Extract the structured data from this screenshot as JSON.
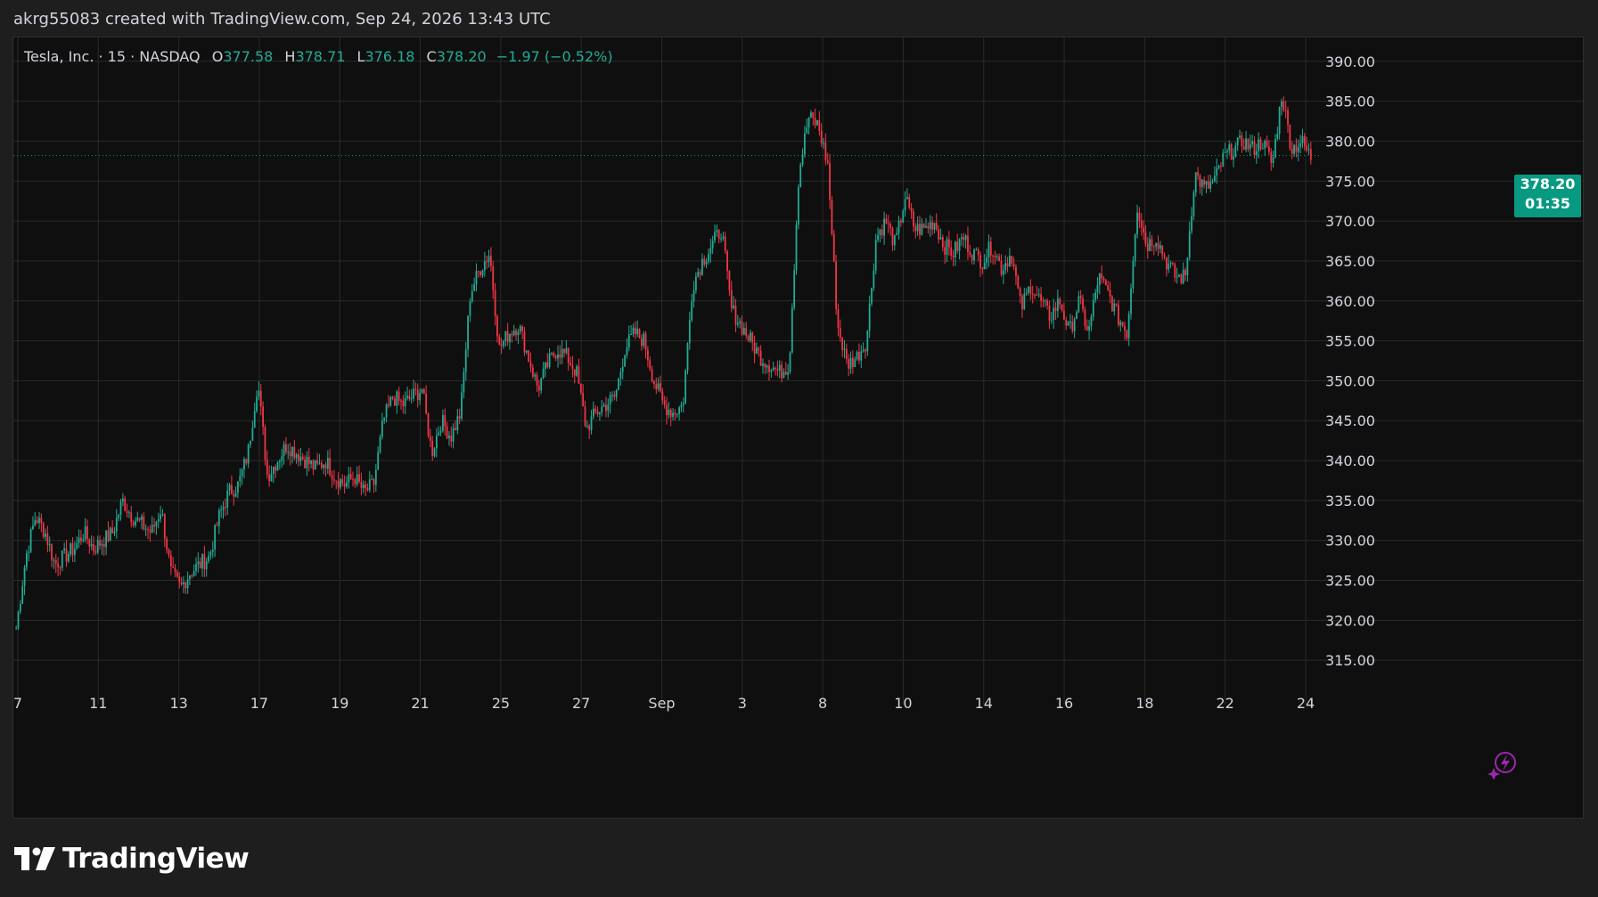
{
  "header": {
    "created_text": "akrg55083 created with TradingView.com, Sep 24, 2026 13:43 UTC"
  },
  "legend": {
    "symbol": "Tesla, Inc. · 15 · NASDAQ",
    "o_label": "O",
    "o_value": "377.58",
    "h_label": "H",
    "h_value": "378.71",
    "l_label": "L",
    "l_value": "376.18",
    "c_label": "C",
    "c_value": "378.20",
    "change": "−1.97 (−0.52%)"
  },
  "price_tag": {
    "price": "378.20",
    "countdown": "01:35"
  },
  "brand": {
    "name": "TradingView"
  },
  "colors": {
    "up": "#22ab94",
    "down": "#f23645",
    "price_tag": "#089981",
    "grid": "#2a2a2a",
    "axis_text": "#d1d4dc",
    "bolt": "#9c27b0"
  },
  "icons": {
    "logo": "tradingview-logo-icon",
    "bolt": "lightning-bolt-icon"
  },
  "chart_data": {
    "type": "candlestick",
    "interval": "15",
    "ylim": [
      311,
      393
    ],
    "y_ticks": [
      "390.00",
      "385.00",
      "380.00",
      "375.00",
      "370.00",
      "365.00",
      "360.00",
      "355.00",
      "350.00",
      "345.00",
      "340.00",
      "335.00",
      "330.00",
      "325.00",
      "320.00",
      "315.00"
    ],
    "x_ticks": [
      "7",
      "11",
      "13",
      "17",
      "19",
      "21",
      "25",
      "27",
      "Sep",
      "3",
      "8",
      "10",
      "14",
      "16",
      "18",
      "22",
      "24"
    ],
    "last_price": 378.2,
    "grid": true,
    "closes": [
      319,
      328,
      333,
      331,
      327,
      328,
      329,
      331,
      329,
      330,
      331,
      335,
      333,
      332,
      331,
      334,
      326,
      324,
      326,
      327,
      328,
      333,
      336,
      337,
      341,
      350,
      338,
      340,
      342,
      341,
      340,
      339,
      340,
      338,
      337,
      338,
      336,
      337,
      345,
      348,
      347,
      348,
      349,
      341,
      345,
      343,
      346,
      361,
      364,
      366,
      354,
      356,
      357,
      353,
      349,
      352,
      354,
      353,
      351,
      344,
      346,
      347,
      348,
      354,
      356,
      355,
      350,
      347,
      346,
      347,
      362,
      365,
      367,
      369,
      359,
      357,
      355,
      353,
      352,
      351,
      352,
      376,
      383,
      382,
      377,
      357,
      352,
      353,
      355,
      368,
      370,
      367,
      373,
      369,
      369,
      370,
      367,
      366,
      368,
      366,
      365,
      367,
      364,
      366,
      359,
      362,
      360,
      358,
      360,
      356,
      360,
      356,
      363,
      361,
      358,
      356,
      372,
      367,
      368,
      365,
      363,
      363,
      376,
      374,
      375,
      378,
      379,
      380,
      379,
      380,
      377,
      386,
      379,
      380,
      378
    ]
  }
}
